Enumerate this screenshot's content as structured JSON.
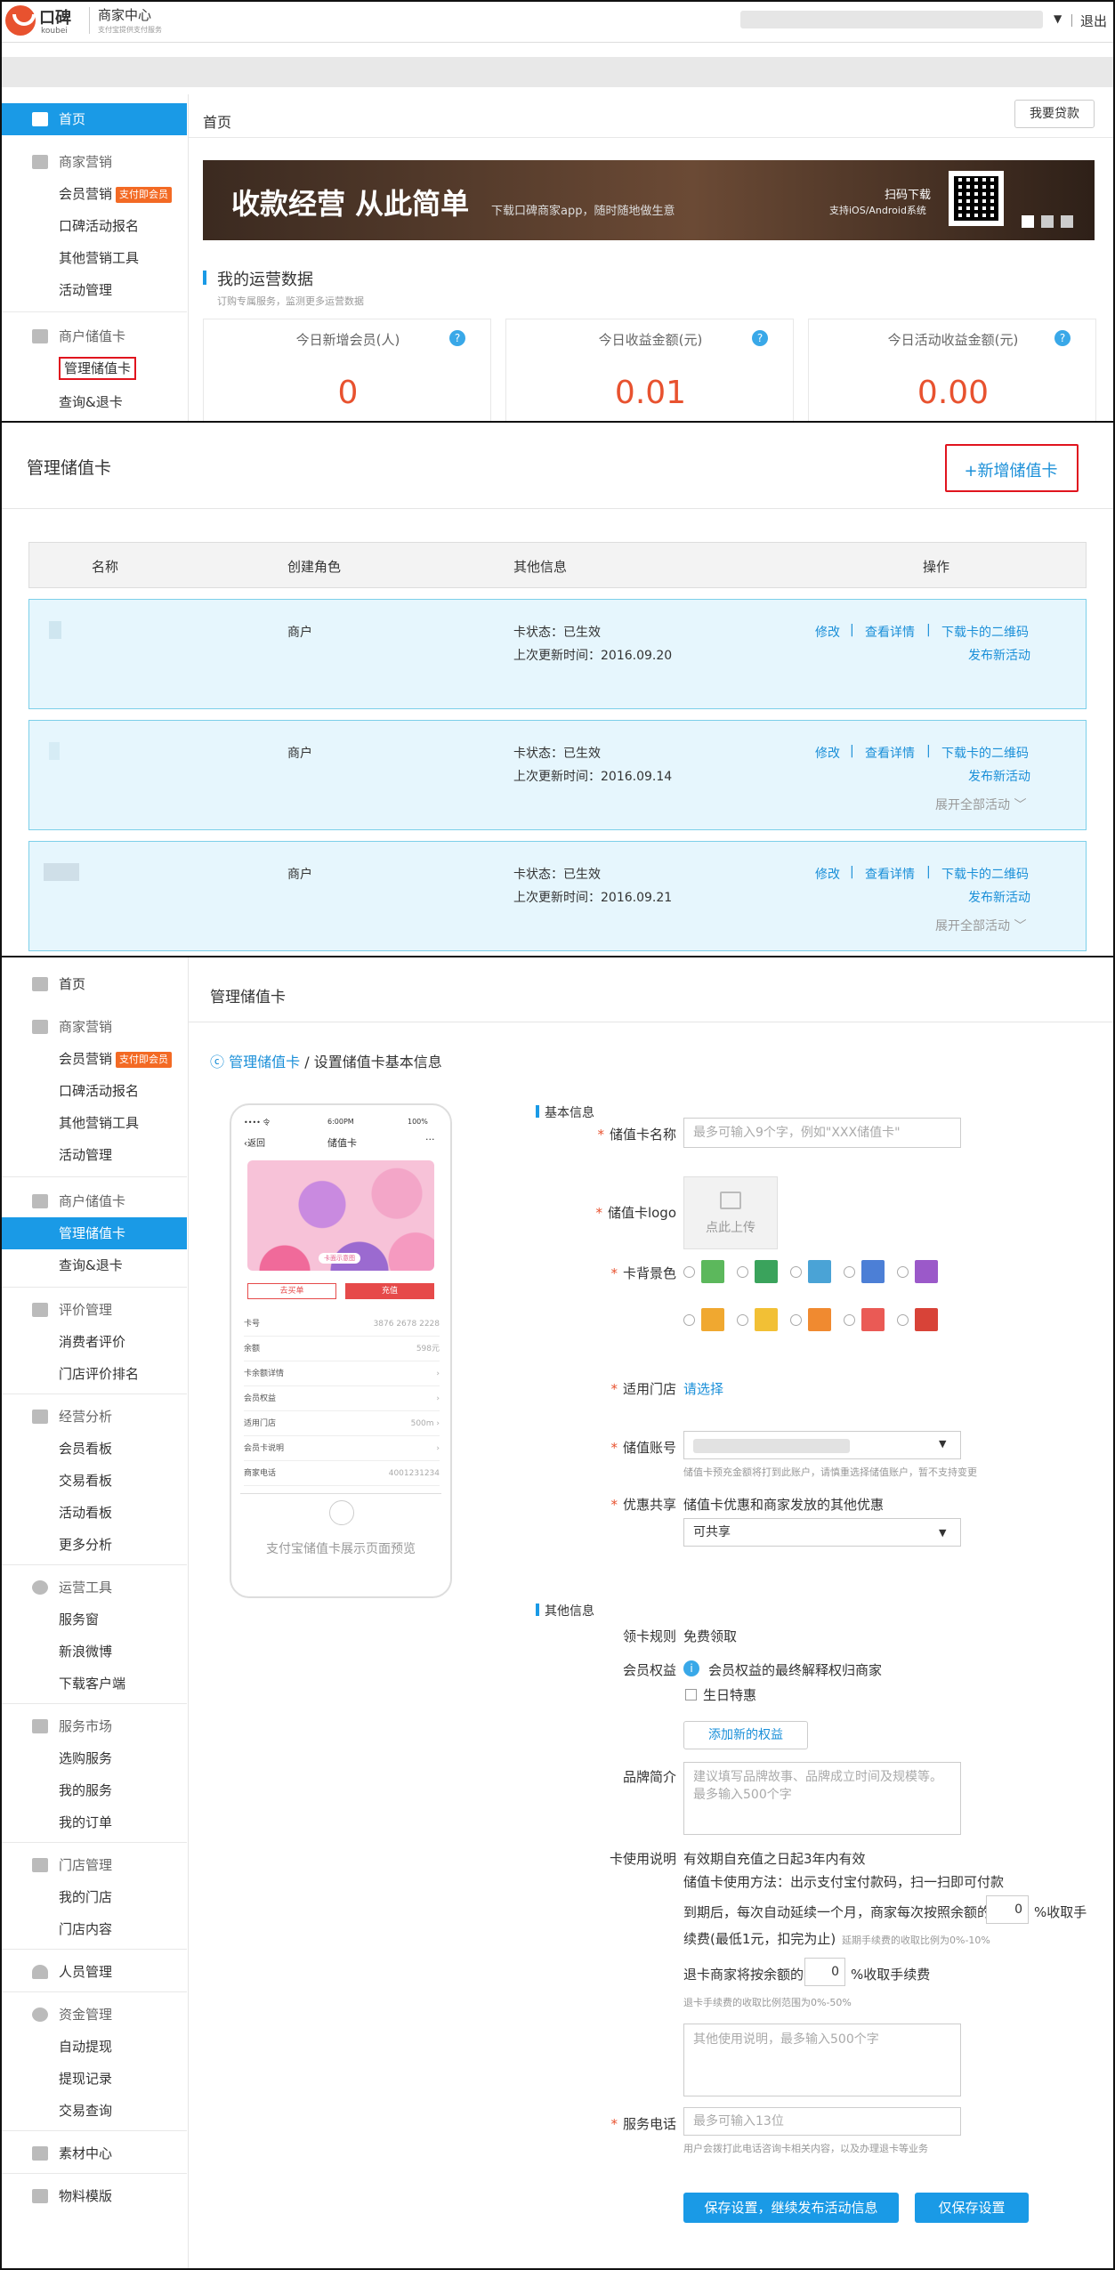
{
  "header": {
    "brand": "口碑",
    "brand_en": "koubei",
    "center_title": "商家中心",
    "center_subtitle": "支付宝提供支付服务",
    "logout": "退出"
  },
  "sidebar": {
    "home": "首页",
    "marketing": "商家营销",
    "member_marketing": "会员营销",
    "member_badge": "支付即会员",
    "koubei_signup": "口碑活动报名",
    "other_tools": "其他营销工具",
    "activity_mgmt": "活动管理",
    "stored_card": "商户储值卡",
    "manage_card": "管理储值卡",
    "query_refund": "查询&退卡",
    "review_mgmt": "评价管理",
    "consumer_review": "消费者评价",
    "store_rank": "门店评价排名",
    "biz_analysis": "经营分析",
    "member_board": "会员看板",
    "trade_board": "交易看板",
    "activity_board": "活动看板",
    "more_analysis": "更多分析",
    "ops_tools": "运营工具",
    "service_window": "服务窗",
    "sina_weibo": "新浪微博",
    "download_client": "下载客户端",
    "service_market": "服务市场",
    "select_service": "选购服务",
    "my_service": "我的服务",
    "my_orders": "我的订单",
    "store_mgmt": "门店管理",
    "my_stores": "我的门店",
    "store_content": "门店内容",
    "staff_mgmt": "人员管理",
    "fund_mgmt": "资金管理",
    "auto_withdraw": "自动提现",
    "withdraw_records": "提现记录",
    "trade_query": "交易查询",
    "material_center": "素材中心",
    "material_template": "物料模版"
  },
  "home": {
    "breadcrumb": "首页",
    "loan_button": "我要贷款",
    "banner_title": "收款经营 从此简单",
    "banner_sub": "下载口碑商家app，随时随地做生意",
    "banner_scan": "扫码下载",
    "banner_support": "支持iOS/Android系统",
    "ops_title": "我的运营数据",
    "ops_subtitle": "订购专属服务，监测更多运营数据",
    "stats": [
      {
        "label": "今日新增会员(人)",
        "value": "0"
      },
      {
        "label": "今日收益金额(元)",
        "value": "0.01"
      },
      {
        "label": "今日活动收益金额(元)",
        "value": "0.00"
      }
    ]
  },
  "card_list": {
    "title": "管理储值卡",
    "add_button": "+新增储值卡",
    "columns": [
      "名称",
      "创建角色",
      "其他信息",
      "操作"
    ],
    "rows": [
      {
        "role": "商户",
        "status": "卡状态：已生效",
        "updated": "上次更新时间：2016.09.20",
        "expand": ""
      },
      {
        "role": "商户",
        "status": "卡状态：已生效",
        "updated": "上次更新时间：2016.09.14",
        "expand": "展开全部活动"
      },
      {
        "role": "商户",
        "status": "卡状态：已生效",
        "updated": "上次更新时间：2016.09.21",
        "expand": "展开全部活动"
      }
    ],
    "actions": {
      "edit": "修改",
      "detail": "查看详情",
      "qrcode": "下载卡的二维码",
      "publish": "发布新活动",
      "sep": "|"
    }
  },
  "form": {
    "page_title": "管理储值卡",
    "crumb_back": "管理储值卡",
    "crumb_current": "/ 设置储值卡基本信息",
    "preview_caption": "支付宝储值卡展示页面预览",
    "phone": {
      "carrier": "•••• 令",
      "time": "6:00PM",
      "battery": "100%",
      "back": "返回",
      "title": "储值卡",
      "more": "···",
      "card_tag": "卡面示意图",
      "btn_buy": "去买单",
      "btn_recharge": "充值",
      "rows": [
        {
          "k": "卡号",
          "v": "3876 2678 2228"
        },
        {
          "k": "余额",
          "v": "598元"
        },
        {
          "k": "卡余额详情",
          "v": "›"
        },
        {
          "k": "会员权益",
          "v": "›"
        },
        {
          "k": "适用门店",
          "v": "500m ›"
        },
        {
          "k": "会员卡说明",
          "v": "›"
        },
        {
          "k": "商家电话",
          "v": "4001231234"
        }
      ]
    },
    "basic_title": "基本信息",
    "name_label": "储值卡名称",
    "name_placeholder": "最多可输入9个字，例如\"XXX储值卡\"",
    "logo_label": "储值卡logo",
    "upload_text": "点此上传",
    "bg_label": "卡背景色",
    "colors_row1": [
      "#5cb85c",
      "#3aa35c",
      "#4aa3d6",
      "#4c7fd6",
      "#9b59c9"
    ],
    "colors_row2": [
      "#f0a830",
      "#f2c035",
      "#f08a30",
      "#ea5a55",
      "#d84338"
    ],
    "store_label": "适用门店",
    "store_select": "请选择",
    "account_label": "储值账号",
    "account_hint": "储值卡预充金额将打到此账户，请慎重选择储值账户，暂不支持变更",
    "share_label": "优惠共享",
    "share_text": "储值卡优惠和商家发放的其他优惠",
    "share_value": "可共享",
    "other_title": "其他信息",
    "claim_label": "领卡规则",
    "claim_value": "免费领取",
    "rights_label": "会员权益",
    "rights_info": "会员权益的最终解释权归商家",
    "birthday": "生日特惠",
    "add_rights": "添加新的权益",
    "brand_label": "品牌简介",
    "brand_placeholder": "建议填写品牌故事、品牌成立时间及规模等。最多输入500个字",
    "usage_label": "卡使用说明",
    "usage_line1": "有效期自充值之日起3年内有效",
    "usage_line2": "储值卡使用方法：出示支付宝付款码，扫一扫即可付款",
    "usage_line3a": "到期后，每次自动延续一个月，商家每次按照余额的",
    "fee_value": "0",
    "usage_line3b": "%收取手",
    "usage_line4": "续费(最低1元，扣完为止)",
    "usage_hint1": "延期手续费的收取比例为0%-10%",
    "refund_a": "退卡商家将按余额的",
    "refund_value": "0",
    "refund_b": "%收取手续费",
    "refund_hint": "退卡手续费的收取比例范围为0%-50%",
    "other_usage_placeholder": "其他使用说明，最多输入500个字",
    "phone_label": "服务电话",
    "phone_placeholder": "最多可输入13位",
    "phone_hint": "用户会拨打此电话咨询卡相关内容，以及办理退卡等业务",
    "save_publish": "保存设置，继续发布活动信息",
    "save_only": "仅保存设置"
  }
}
